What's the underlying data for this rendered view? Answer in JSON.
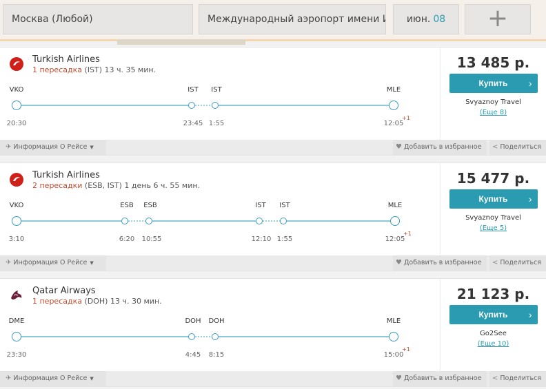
{
  "search": {
    "from": "Москва (Любой)",
    "to": "Международный аэропорт имени И...",
    "date_month": "июн.",
    "date_day": "08",
    "add": "+"
  },
  "colors": {
    "accent": "#2a9bb0",
    "stop_red": "#c64a2c"
  },
  "flights": [
    {
      "airline": "Turkish Airlines",
      "logo": "turkish-airlines-logo",
      "stops_label": "1 пересадка",
      "stops_detail": " (IST) 13 ч. 35 мин.",
      "price": "13 485 р.",
      "buy": "Купить",
      "agency": "Svyaznoy Travel",
      "more": "(Еще 8)",
      "codes": [
        "VKO",
        "IST",
        "IST",
        "MLE"
      ],
      "times": [
        "20:30",
        "23:45",
        "1:55",
        "12:05"
      ],
      "plus_day": "+1"
    },
    {
      "airline": "Turkish Airlines",
      "logo": "turkish-airlines-logo",
      "stops_label": "2 пересадки",
      "stops_detail": " (ESB, IST) 1 день 6 ч. 55 мин.",
      "price": "15 477 р.",
      "buy": "Купить",
      "agency": "Svyaznoy Travel",
      "more": "(Еще 5)",
      "codes": [
        "VKO",
        "ESB",
        "ESB",
        "IST",
        "IST",
        "MLE"
      ],
      "times": [
        "3:10",
        "6:20",
        "10:55",
        "12:10",
        "1:55",
        "12:05"
      ],
      "plus_day": "+1"
    },
    {
      "airline": "Qatar Airways",
      "logo": "qatar-airways-logo",
      "stops_label": "1 пересадка",
      "stops_detail": " (DOH) 13 ч. 30 мин.",
      "price": "21 123 р.",
      "buy": "Купить",
      "agency": "Go2See",
      "more": "(Еще 10)",
      "codes": [
        "DME",
        "DOH",
        "DOH",
        "MLE"
      ],
      "times": [
        "23:30",
        "4:45",
        "8:15",
        "15:00"
      ],
      "plus_day": "+1"
    }
  ],
  "footer": {
    "info": "Информация О Рейсе",
    "favorite": "Добавить в избранное",
    "share": "Поделиться"
  }
}
